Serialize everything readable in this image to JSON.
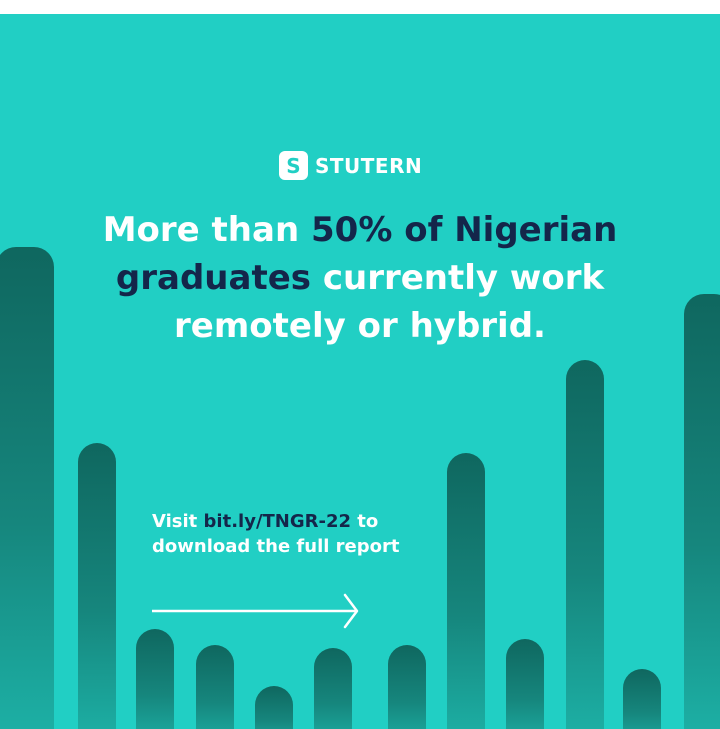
{
  "brand": {
    "logo_letter": "S",
    "name": "STUTERN"
  },
  "headline": {
    "part1": "More than ",
    "highlight1": "50% of Nigerian graduates",
    "part2": " currently work remotely or hybrid."
  },
  "cta": {
    "prefix": "Visit ",
    "link": "bit.ly/TNGR-22",
    "suffix": " to download the full report"
  },
  "colors": {
    "background": "#21cfc4",
    "highlight": "#14264a",
    "bar_dark": "#0f675f",
    "text": "#ffffff"
  },
  "decorative_bars": [
    {
      "level": 0.67
    },
    {
      "level": 0.4
    },
    {
      "level": 0.14
    },
    {
      "level": 0.12
    },
    {
      "level": 0.06
    },
    {
      "level": 0.12
    },
    {
      "level": 0.12
    },
    {
      "level": 0.38
    },
    {
      "level": 0.13
    },
    {
      "level": 0.52
    },
    {
      "level": 0.07
    },
    {
      "level": 0.6
    }
  ]
}
